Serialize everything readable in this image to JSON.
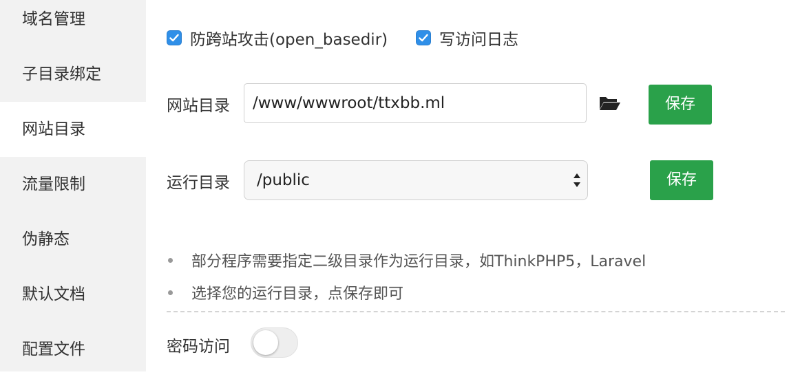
{
  "sidebar": {
    "items": [
      {
        "label": "域名管理"
      },
      {
        "label": "子目录绑定"
      },
      {
        "label": "网站目录",
        "active": true
      },
      {
        "label": "流量限制"
      },
      {
        "label": "伪静态"
      },
      {
        "label": "默认文档"
      },
      {
        "label": "配置文件"
      }
    ]
  },
  "options": {
    "open_basedir": {
      "label": "防跨站攻击(open_basedir)",
      "checked": true
    },
    "access_log": {
      "label": "写访问日志",
      "checked": true
    }
  },
  "site_dir": {
    "label": "网站目录",
    "value": "/www/wwwroot/ttxbb.ml",
    "folder_icon": "folder-open-icon",
    "save_label": "保存"
  },
  "run_dir": {
    "label": "运行目录",
    "selected": "/public",
    "save_label": "保存"
  },
  "tips": [
    "部分程序需要指定二级目录作为运行目录，如ThinkPHP5，Laravel",
    "选择您的运行目录，点保存即可"
  ],
  "password_access": {
    "label": "密码访问",
    "enabled": false
  },
  "colors": {
    "accent": "#2aa14a",
    "checkbox": "#2f8fe8",
    "sidebar_bg": "#f2f2f2"
  }
}
